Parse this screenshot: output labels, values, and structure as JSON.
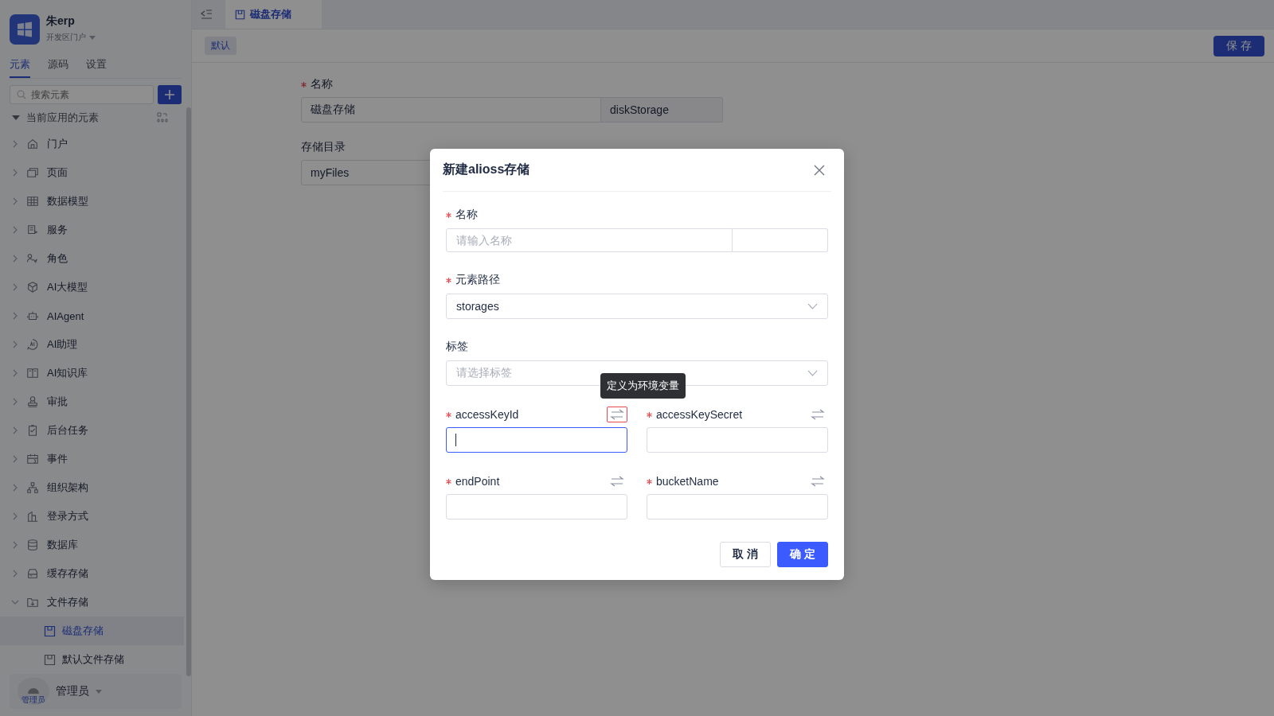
{
  "app": {
    "name": "朱erp",
    "portal": "开发区门户"
  },
  "sidebar": {
    "tabs": [
      {
        "label": "元素",
        "selected": true
      },
      {
        "label": "源码",
        "selected": false
      },
      {
        "label": "设置",
        "selected": false
      }
    ],
    "search": {
      "placeholder": "搜索元素"
    },
    "tree": {
      "label": "当前应用的元素",
      "expanded": true,
      "children": [
        {
          "label": "门户",
          "expanded": false
        },
        {
          "label": "页面",
          "expanded": false
        },
        {
          "label": "数据模型",
          "expanded": false
        },
        {
          "label": "服务",
          "expanded": false
        },
        {
          "label": "角色",
          "expanded": false
        },
        {
          "label": "AI大模型",
          "expanded": false
        },
        {
          "label": "AIAgent",
          "expanded": false
        },
        {
          "label": "AI助理",
          "expanded": false
        },
        {
          "label": "AI知识库",
          "expanded": false
        },
        {
          "label": "审批",
          "expanded": false
        },
        {
          "label": "后台任务",
          "expanded": false
        },
        {
          "label": "事件",
          "expanded": false
        },
        {
          "label": "组织架构",
          "expanded": false
        },
        {
          "label": "登录方式",
          "expanded": false
        },
        {
          "label": "数据库",
          "expanded": false
        },
        {
          "label": "缓存存储",
          "expanded": false
        },
        {
          "label": "文件存储",
          "expanded": true,
          "children": [
            {
              "label": "磁盘存储",
              "selected": true
            },
            {
              "label": "默认文件存储",
              "selected": false
            }
          ]
        }
      ]
    },
    "user": {
      "name": "管理员",
      "avatar_label": "管理员"
    }
  },
  "editor_tabs": [
    {
      "label": "磁盘存储",
      "selected": true
    }
  ],
  "toolbar": {
    "tag": "默认",
    "save_button": "保 存"
  },
  "form": {
    "fields": [
      {
        "label": "名称",
        "required": true,
        "value": "磁盘存储",
        "suffix": "diskStorage"
      },
      {
        "label": "存储目录",
        "required": false,
        "value": "myFiles"
      }
    ]
  },
  "dialog": {
    "title": "新建alioss存储",
    "fields": [
      {
        "kind": "text-suffix",
        "label": "名称",
        "required": true,
        "placeholder": "请输入名称"
      },
      {
        "kind": "select",
        "label": "元素路径",
        "required": true,
        "value": "storages"
      },
      {
        "kind": "select",
        "label": "标签",
        "required": false,
        "placeholder": "请选择标签"
      }
    ],
    "env_fields": [
      {
        "label": "accessKeyId",
        "required": true,
        "focused": true
      },
      {
        "label": "accessKeySecret",
        "required": true,
        "focused": false
      },
      {
        "label": "endPoint",
        "required": true,
        "focused": false
      },
      {
        "label": "bucketName",
        "required": true,
        "focused": false
      }
    ],
    "tooltip": "定义为环境变量",
    "buttons": [
      {
        "label": "取 消",
        "kind": "default"
      },
      {
        "label": "确 定",
        "kind": "primary"
      }
    ]
  }
}
